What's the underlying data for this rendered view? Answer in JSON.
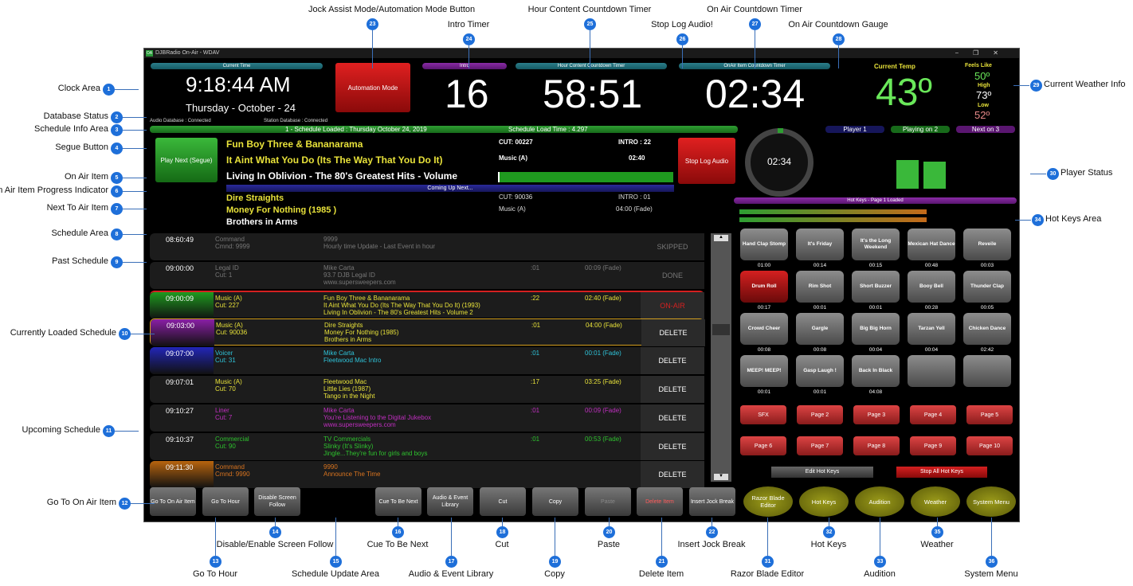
{
  "window": {
    "title": "DJBRadio On-Air - WDAV",
    "logo": "OA",
    "controls": [
      "−",
      "❐",
      "✕"
    ]
  },
  "clock": {
    "header": "Current Time",
    "time": "9:18:44 AM",
    "date": "Thursday - October - 24"
  },
  "db_status": {
    "audio": "Audio Database : Connected",
    "station": "Station Database : Connected"
  },
  "automation_button": "Automation Mode",
  "intro_timer": {
    "header": "Intro",
    "value": "16"
  },
  "hour_timer": {
    "header": "Hour Content Countdown Timer",
    "value": "58:51"
  },
  "onair_timer": {
    "header": "OnAir Item Countdown Timer",
    "value": "02:34"
  },
  "weather": {
    "current_label": "Current Temp",
    "current": "43º",
    "feels_label": "Feels Like",
    "feels": "50º",
    "high_label": "High",
    "high": "73º",
    "low_label": "Low",
    "low": "52º"
  },
  "schedule_info": {
    "loaded": "1 - Schedule Loaded : Thursday October 24, 2019",
    "load_time": "Schedule Load Time : 4.297"
  },
  "segue_button": "Play Next (Segue)",
  "stop_log_button": "Stop Log Audio",
  "on_air": {
    "artist": "Fun Boy Three & Bananarama",
    "title": "It Aint What You Do (Its The Way That You Do It)",
    "album": "Living In Oblivion - The 80's Greatest Hits - Volume",
    "cut": "CUT: 00227",
    "intro": "INTRO : 22",
    "category": "Music (A)",
    "duration": "02:40",
    "progress": 0.01
  },
  "coming_up_label": "Coming Up Next...",
  "next": {
    "artist": "Dire Straights",
    "title": "Money For Nothing (1985 )",
    "album": "Brothers in Arms",
    "cut": "CUT: 90036",
    "intro": "INTRO : 01",
    "category": "Music (A)",
    "duration": "04:00 (Fade)"
  },
  "gauge": {
    "value": "02:34"
  },
  "players": [
    "Player 1",
    "Playing on 2",
    "Next on 3"
  ],
  "hotkeys_header": "Hot Keys - Page  1 Loaded",
  "schedule": [
    {
      "time": "08:60:49",
      "cat": [
        "Command",
        "Cmnd: 9999"
      ],
      "info": [
        "9999",
        "Hourly time Update - Last Event in hour"
      ],
      "intro": "",
      "dur": "",
      "action": "SKIPPED",
      "color": "#777",
      "band": ""
    },
    {
      "time": "09:00:00",
      "cat": [
        "Legal ID",
        "Cut: 1"
      ],
      "info": [
        "Mike Carta",
        "93.7 DJB Legal ID",
        "www.supersweepers.com"
      ],
      "intro": ":01",
      "dur": "00:09 (Fade)",
      "action": "DONE",
      "color": "#777",
      "band": ""
    },
    {
      "time": "09:00:09",
      "cat": [
        "Music (A)",
        "Cut: 227"
      ],
      "info": [
        "Fun Boy Three & Bananarama",
        "It Aint What You Do (Its The Way That You Do It)  (1993)",
        "Living In Oblivion - The 80's Greatest Hits - Volume 2"
      ],
      "intro": ":22",
      "dur": "02:40 (Fade)",
      "action": "ON-AIR",
      "color": "#e8e23a",
      "band": "#1f9a1f"
    },
    {
      "time": "09:03:00",
      "cat": [
        "Music (A)",
        "Cut: 90036"
      ],
      "info": [
        "Dire Straights",
        "Money For Nothing  (1985)",
        "Brothers in Arms"
      ],
      "intro": ":01",
      "dur": "04:00 (Fade)",
      "action": "DELETE",
      "color": "#e8e23a",
      "band": "#8a1fa6"
    },
    {
      "time": "09:07:00",
      "cat": [
        "Voicer",
        "Cut: 31"
      ],
      "info": [
        "Mike Carta",
        "Fleetwood Mac Intro"
      ],
      "intro": ":01",
      "dur": "00:01 (Fade)",
      "action": "DELETE",
      "color": "#2fc3d9",
      "band": "#2226b8"
    },
    {
      "time": "09:07:01",
      "cat": [
        "Music (A)",
        "Cut: 70"
      ],
      "info": [
        "Fleetwood Mac",
        "Little Lies  (1987)",
        "Tango in the Night"
      ],
      "intro": ":17",
      "dur": "03:25 (Fade)",
      "action": "DELETE",
      "color": "#e8e23a",
      "band": ""
    },
    {
      "time": "09:10:27",
      "cat": [
        "Liner",
        "Cut: 7"
      ],
      "info": [
        "Mike Carta",
        "You're Listening to the Digital Jukebox",
        "www.supersweepers.com"
      ],
      "intro": ":01",
      "dur": "00:09 (Fade)",
      "action": "DELETE",
      "color": "#c02fc0",
      "band": ""
    },
    {
      "time": "09:10:37",
      "cat": [
        "Commercial",
        "Cut: 90"
      ],
      "info": [
        "TV Commercials",
        "Slinky (It's Slinky)",
        "Jingle...They're fun for girls and boys"
      ],
      "intro": ":01",
      "dur": "00:53 (Fade)",
      "action": "DELETE",
      "color": "#2ec22e",
      "band": ""
    },
    {
      "time": "09:11:30",
      "cat": [
        "Command",
        "Cmnd: 9990"
      ],
      "info": [
        "9990",
        "Announce The Time"
      ],
      "intro": "",
      "dur": "",
      "action": "DELETE",
      "color": "#d9741f",
      "band": "#b8640e"
    }
  ],
  "hotkeys": [
    {
      "label": "Hand Clap Stomp",
      "time": "01:00"
    },
    {
      "label": "It's Friday",
      "time": "00:14"
    },
    {
      "label": "It's the Long Weekend",
      "time": "00:15"
    },
    {
      "label": "Mexican Hat Dance",
      "time": "00:48"
    },
    {
      "label": "Reveile",
      "time": "00:03"
    },
    {
      "label": "Drum Roll",
      "time": "00:17"
    },
    {
      "label": "Rim Shot",
      "time": "00:01"
    },
    {
      "label": "Short Buzzer",
      "time": "00:01"
    },
    {
      "label": "Booy Bell",
      "time": "00:28"
    },
    {
      "label": "Thunder Clap",
      "time": "00:05"
    },
    {
      "label": "Crowd Cheer",
      "time": "00:08"
    },
    {
      "label": "Gargle",
      "time": "00:08"
    },
    {
      "label": "Big Big Horn",
      "time": "00:04"
    },
    {
      "label": "Tarzan Yell",
      "time": "00:04"
    },
    {
      "label": "Chicken Dance",
      "time": "02:42"
    },
    {
      "label": "MEEP! MEEP!",
      "time": "00:01"
    },
    {
      "label": "Gasp Laugh !",
      "time": "00:01"
    },
    {
      "label": "Back In Black",
      "time": "04:08"
    },
    {
      "label": "",
      "time": ""
    },
    {
      "label": "",
      "time": ""
    }
  ],
  "pages": [
    "SFX",
    "Page 2",
    "Page 3",
    "Page 4",
    "Page 5",
    "Page 6",
    "Page 7",
    "Page 8",
    "Page 9",
    "Page 10"
  ],
  "edit_hotkeys": "Edit Hot Keys",
  "stop_hotkeys": "Stop All Hot Keys",
  "bottom_buttons": [
    "Go To On Air Item",
    "Go To Hour",
    "Disable Screen Follow",
    "Cue To Be Next",
    "Audio & Event Library",
    "Cut",
    "Copy",
    "Paste",
    "Delete Item",
    "Insert Jock Break"
  ],
  "round_buttons": [
    "Razor Blade Editor",
    "Hot Keys",
    "Audition",
    "Weather",
    "System Menu"
  ],
  "callouts": {
    "c1": "Clock Area",
    "c2": "Database Status",
    "c3": "Schedule Info Area",
    "c4": "Segue Button",
    "c5": "On Air Item",
    "c6": "On Air Item Progress Indicator",
    "c7": "Next To Air Item",
    "c8": "Schedule Area",
    "c9": "Past Schedule",
    "c10": "Currently Loaded Schedule",
    "c11": "Upcoming Schedule",
    "c12": "Go To On Air Item",
    "c13": "Go To Hour",
    "c14": "Disable/Enable Screen Follow",
    "c15": "Schedule Update Area",
    "c16": "Cue To Be Next",
    "c17": "Audio & Event Library",
    "c18": "Cut",
    "c19": "Copy",
    "c20": "Paste",
    "c21": "Delete Item",
    "c22": "Insert Jock Break",
    "c23": "Jock Assist Mode/Automation Mode Button",
    "c24": "Intro Timer",
    "c25": "Hour Content Countdown Timer",
    "c26": "Stop Log Audio!",
    "c27": "On Air Countdown Timer",
    "c28": "On Air Countdown Gauge",
    "c29": "Current Weather Info",
    "c30": "Player Status",
    "c31": "Razor Blade Editor",
    "c32": "Hot Keys",
    "c33": "Audition",
    "c34": "Hot Keys Area",
    "c35": "Weather",
    "c36": "System Menu"
  }
}
